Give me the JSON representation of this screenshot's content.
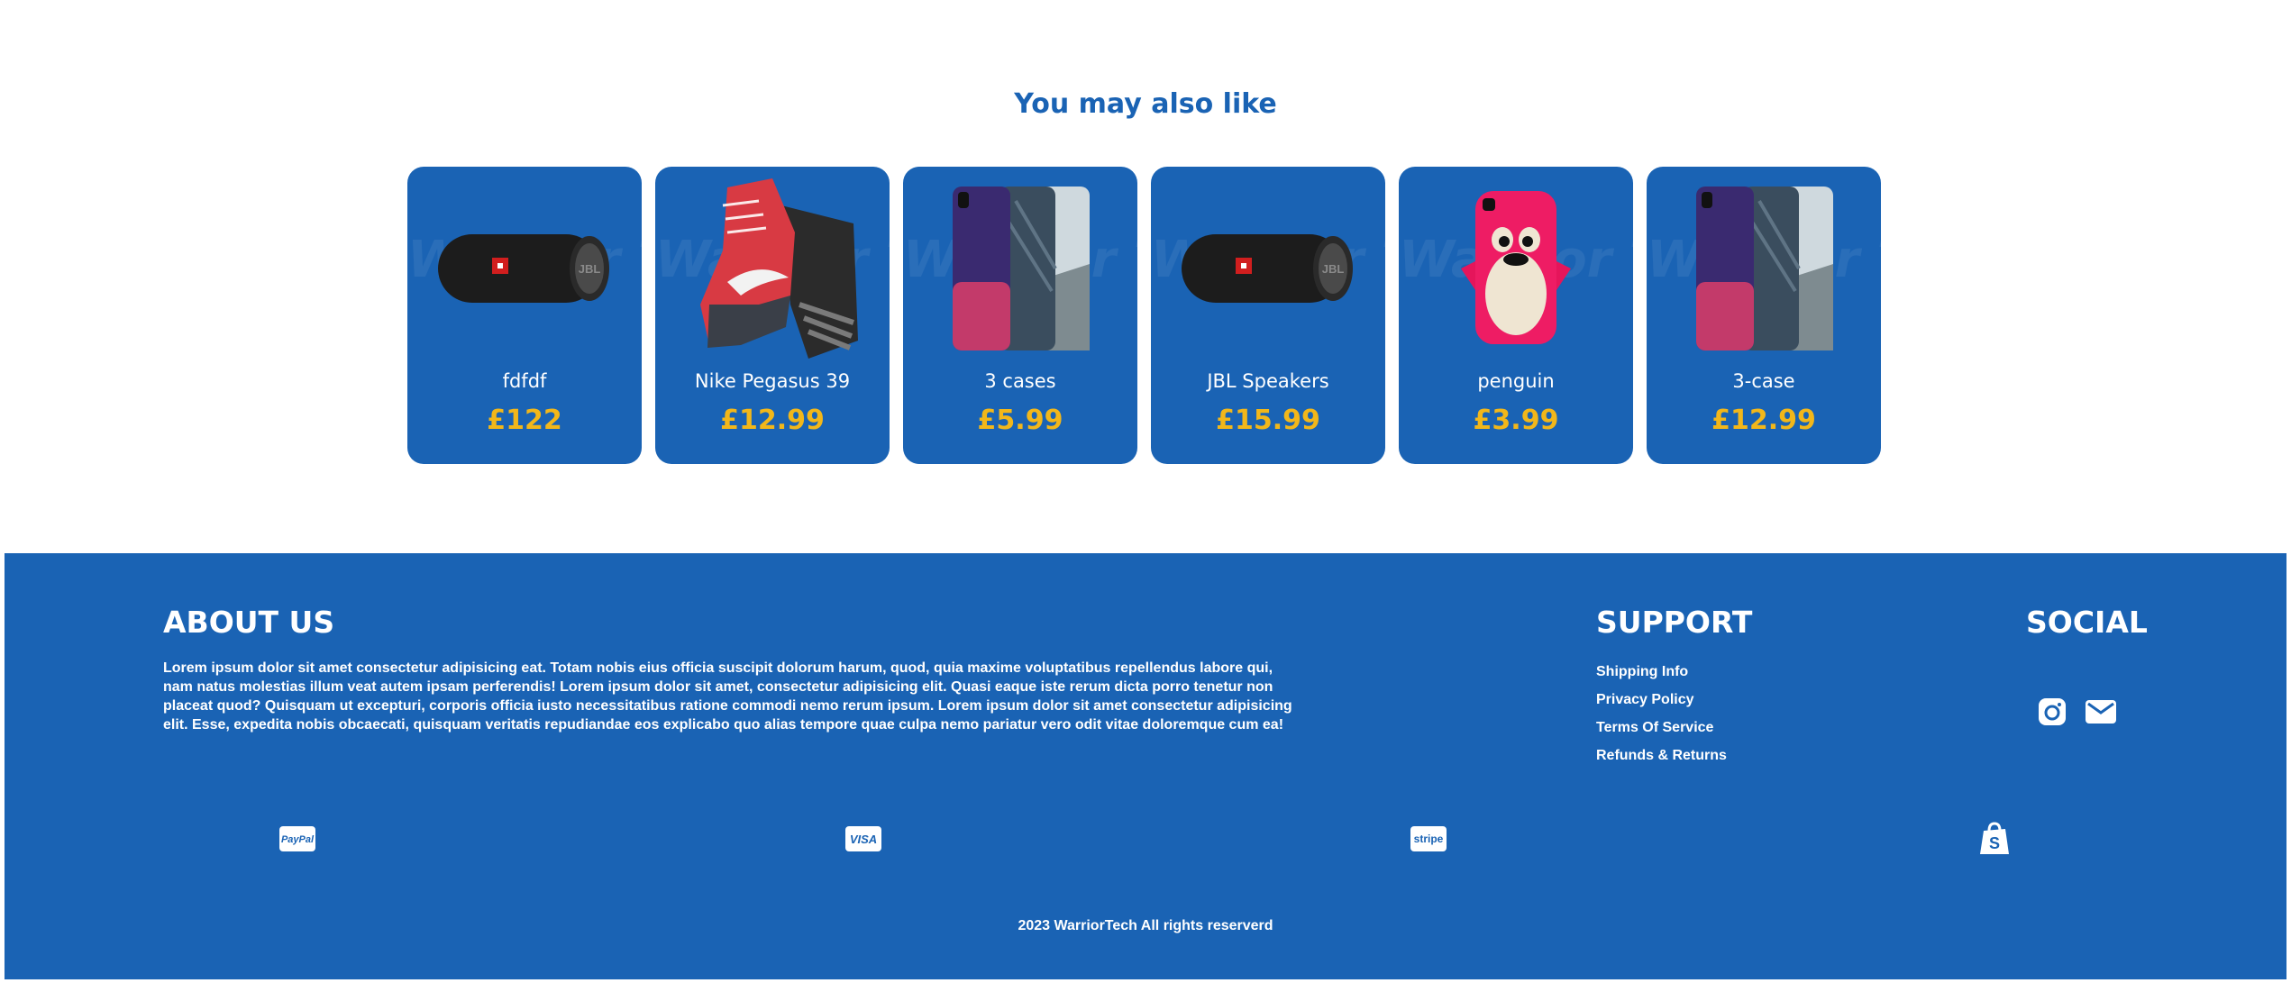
{
  "recommendations": {
    "title": "You may also like",
    "watermark": "Warrior Tech",
    "items": [
      {
        "name": "fdfdf",
        "price": "£122",
        "image": "speaker-image"
      },
      {
        "name": "Nike Pegasus 39",
        "price": "£12.99",
        "image": "sneakers-image"
      },
      {
        "name": "3 cases",
        "price": "£5.99",
        "image": "phone-cases-image"
      },
      {
        "name": "JBL Speakers",
        "price": "£15.99",
        "image": "speaker-image"
      },
      {
        "name": "penguin",
        "price": "£3.99",
        "image": "penguin-case-image"
      },
      {
        "name": "3-case",
        "price": "£12.99",
        "image": "phone-cases-image"
      }
    ]
  },
  "footer": {
    "about": {
      "heading": "ABOUT US",
      "text": "Lorem ipsum dolor sit amet consectetur adipisicing eat. Totam nobis eius officia suscipit dolorum harum, quod, quia maxime voluptatibus repellendus labore qui, nam natus molestias illum veat autem ipsam perferendis! Lorem ipsum dolor sit amet, consectetur adipisicing elit. Quasi eaque iste rerum dicta porro tenetur non placeat quod? Quisquam ut excepturi, corporis officia iusto necessitatibus ratione commodi nemo rerum ipsum. Lorem ipsum dolor sit amet consectetur adipisicing elit. Esse, expedita nobis obcaecati, quisquam veritatis repudiandae eos explicabo quo alias tempore quae culpa nemo pariatur vero odit vitae doloremque cum ea!"
    },
    "support": {
      "heading": "SUPPORT",
      "links": [
        "Shipping Info",
        "Privacy Policy",
        "Terms Of Service",
        "Refunds & Returns"
      ]
    },
    "social": {
      "heading": "SOCIAL",
      "icons": [
        "instagram-icon",
        "mail-icon"
      ]
    },
    "payments": {
      "paypal": "PayPal",
      "visa": "VISA",
      "stripe": "stripe",
      "shopify": "shopify-icon"
    },
    "copyright": "2023 WarriorTech All rights reserverd"
  },
  "colors": {
    "brand_blue": "#1a63b4",
    "price_gold": "#f2b71a",
    "background": "#ffffff"
  }
}
